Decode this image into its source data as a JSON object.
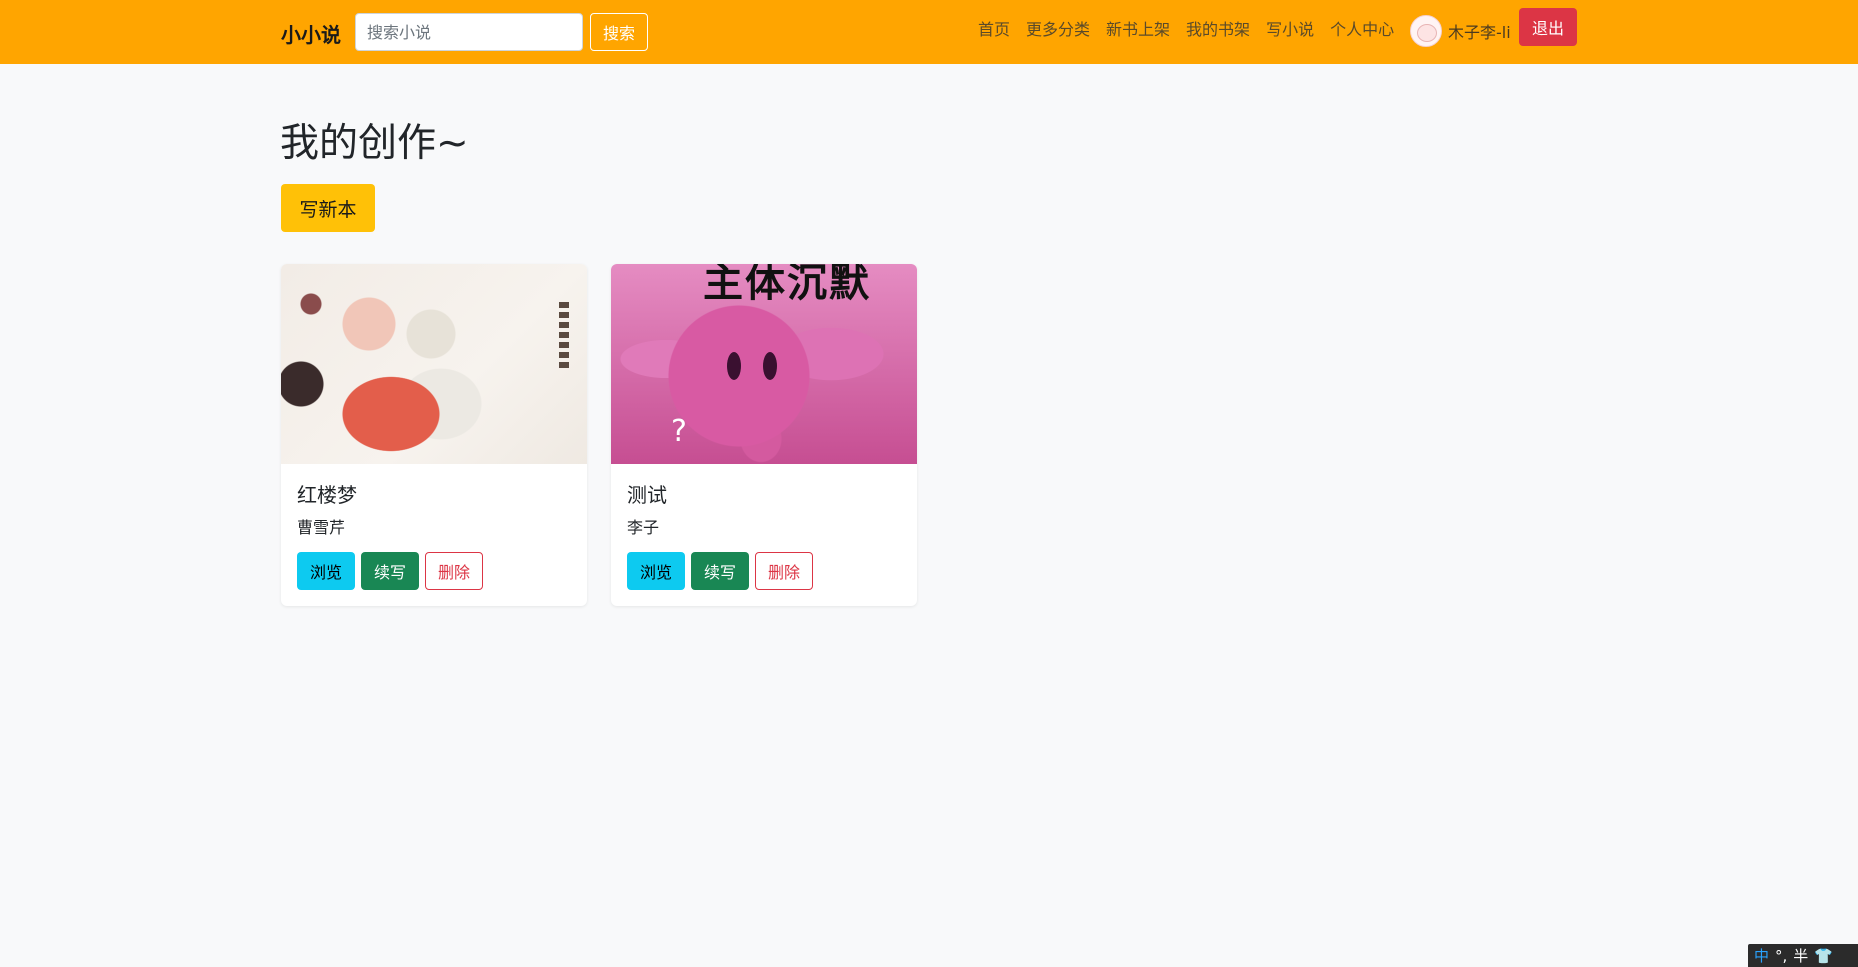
{
  "navbar": {
    "brand": "小小说",
    "search_placeholder": "搜索小说",
    "search_button": "搜索",
    "links": [
      "首页",
      "更多分类",
      "新书上架",
      "我的书架",
      "写小说",
      "个人中心"
    ],
    "username": "木子李-li",
    "logout": "退出"
  },
  "main": {
    "title": "我的创作~",
    "new_book_button": "写新本",
    "books": [
      {
        "title": "红楼梦",
        "author": "曹雪芹",
        "browse": "浏览",
        "continue": "续写",
        "delete": "删除"
      },
      {
        "title": "测试",
        "author": "李子",
        "browse": "浏览",
        "continue": "续写",
        "delete": "删除",
        "cover_text": "主体沉默",
        "cover_mark": "?"
      }
    ]
  },
  "ime": {
    "mode": "中",
    "punct": "°,",
    "width": "半"
  },
  "colors": {
    "navbar": "#ffa500",
    "new_book": "#ffc107",
    "info": "#0dcaf0",
    "success": "#198754",
    "danger": "#dc3545"
  }
}
